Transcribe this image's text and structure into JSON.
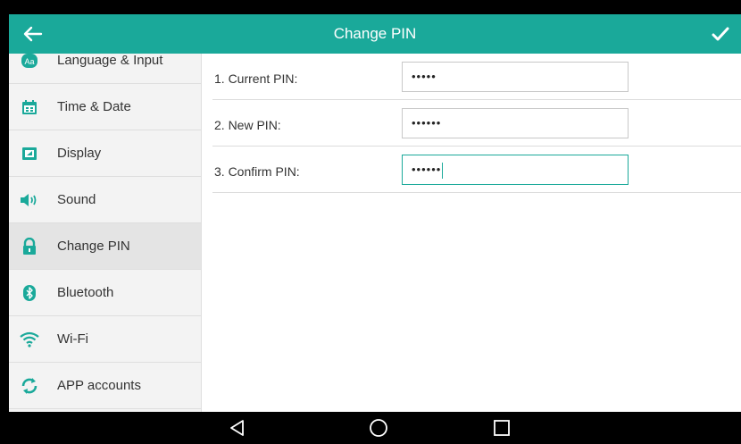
{
  "titlebar": {
    "title": "Change PIN",
    "back_icon": "arrow-left-icon",
    "confirm_icon": "checkmark-icon"
  },
  "colors": {
    "accent": "#1aa99a",
    "sidebar_bg": "#f3f3f3",
    "active_bg": "#e4e4e4",
    "navbar_bg": "#000000"
  },
  "sidebar": {
    "items": [
      {
        "label": "Language & Input",
        "icon": "language-icon"
      },
      {
        "label": "Time & Date",
        "icon": "calendar-icon"
      },
      {
        "label": "Display",
        "icon": "display-icon"
      },
      {
        "label": "Sound",
        "icon": "speaker-icon"
      },
      {
        "label": "Change PIN",
        "icon": "lock-icon",
        "active": true
      },
      {
        "label": "Bluetooth",
        "icon": "bluetooth-icon"
      },
      {
        "label": "Wi-Fi",
        "icon": "wifi-icon"
      },
      {
        "label": "APP accounts",
        "icon": "sync-icon"
      }
    ]
  },
  "form": {
    "rows": [
      {
        "label": "1. Current PIN:",
        "value": "•••••"
      },
      {
        "label": "2. New PIN:",
        "value": "••••••"
      },
      {
        "label": "3. Confirm PIN:",
        "value": "••••••",
        "focused": true
      }
    ]
  },
  "navbar": {
    "buttons": [
      {
        "icon": "back-triangle-icon"
      },
      {
        "icon": "home-circle-icon"
      },
      {
        "icon": "recents-square-icon"
      }
    ]
  }
}
